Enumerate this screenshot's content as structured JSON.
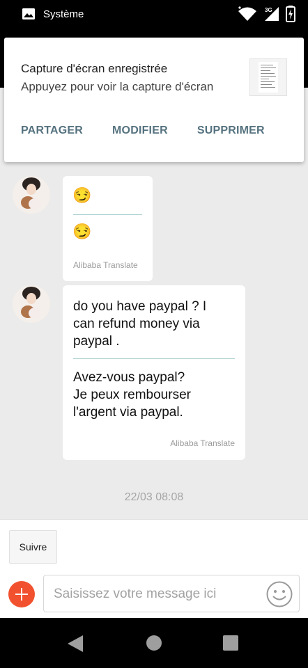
{
  "status_bar": {
    "label": "Système",
    "icons": [
      "image-icon",
      "wifi-icon",
      "signal-3g-icon",
      "battery-charging-icon"
    ]
  },
  "notification": {
    "title": "Capture d'écran enregistrée",
    "subtitle": "Appuyez pour voir la capture d'écran",
    "actions": [
      "PARTAGER",
      "MODIFIER",
      "SUPPRIMER"
    ]
  },
  "messages": [
    {
      "original": "😏",
      "translated": "😏",
      "source": "Alibaba Translate"
    },
    {
      "original": "do you have paypal ? I\ncan refund money via\npaypal .",
      "translated": "Avez-vous paypal?\nJe peux rembourser\nl'argent via paypal.",
      "source": "Alibaba Translate"
    }
  ],
  "timestamp": "22/03 08:08",
  "composer": {
    "follow_label": "Suivre",
    "placeholder": "Saisissez votre message ici"
  },
  "colors": {
    "accent": "#f2512f",
    "action_text": "#55727f",
    "chat_bg": "#ebebeb",
    "divider": "#a9cfcf"
  }
}
